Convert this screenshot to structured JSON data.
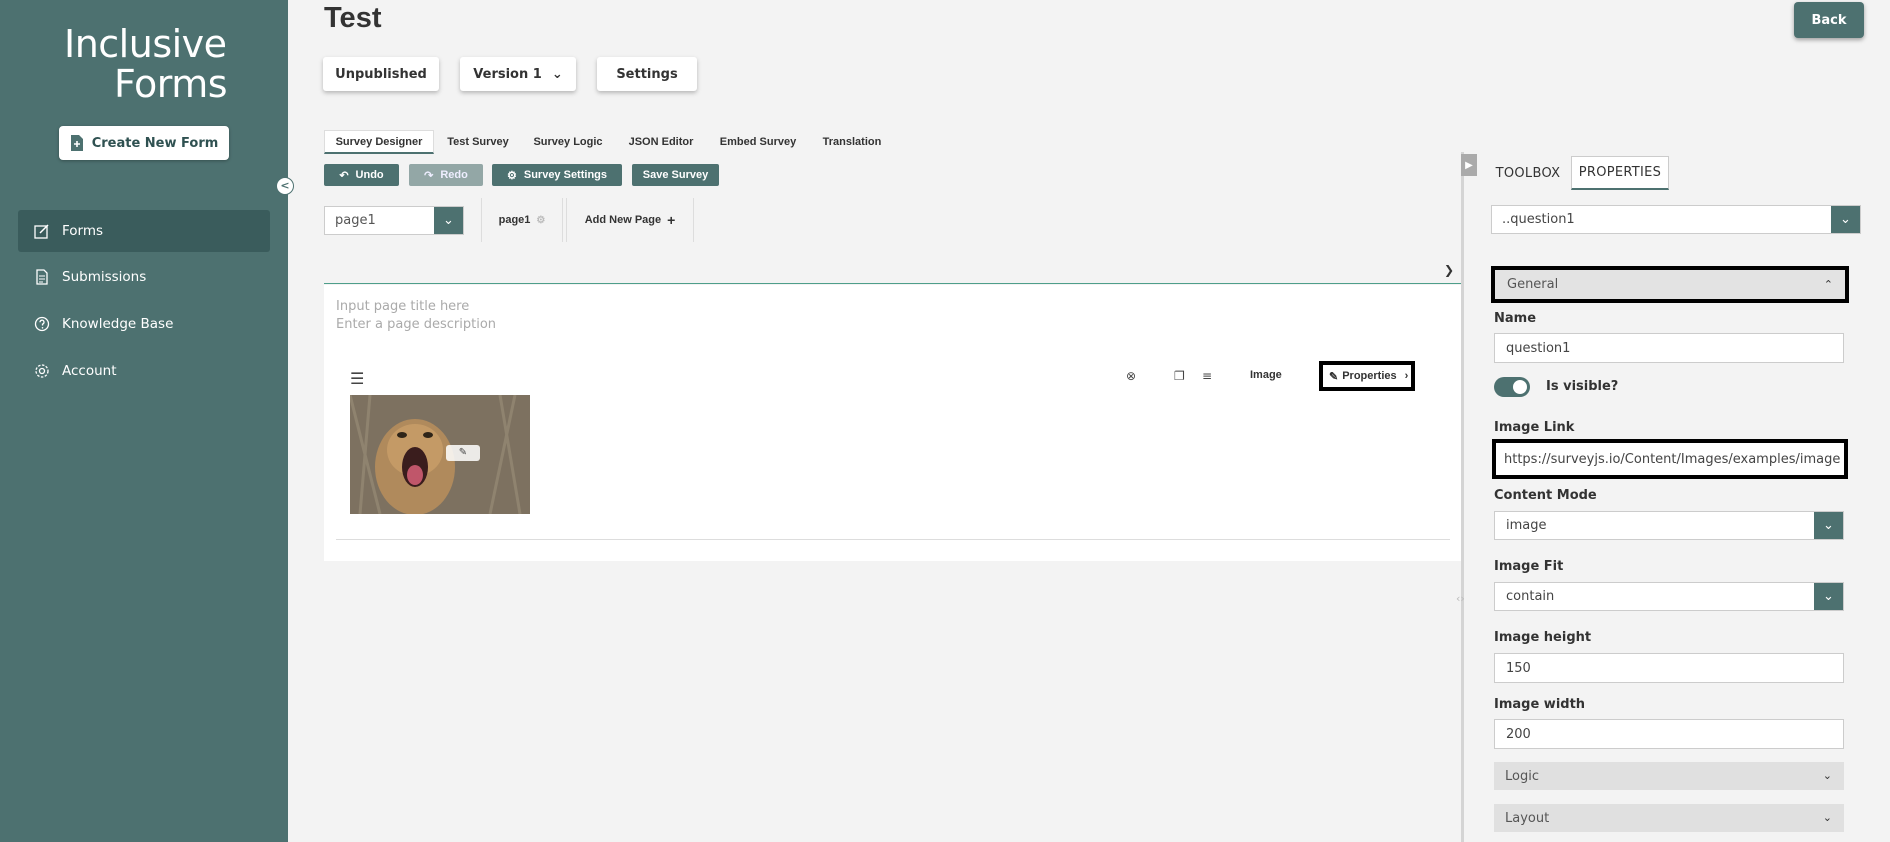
{
  "sidebar": {
    "logo_line1": "Inclusive",
    "logo_line2": "Forms",
    "create_label": "Create New Form",
    "collapse_glyph": "<",
    "items": [
      {
        "label": "Forms",
        "icon": "edit-icon"
      },
      {
        "label": "Submissions",
        "icon": "document-icon"
      },
      {
        "label": "Knowledge Base",
        "icon": "help-icon"
      },
      {
        "label": "Account",
        "icon": "gear-icon"
      }
    ]
  },
  "header": {
    "title": "Test",
    "back_label": "Back",
    "buttons": {
      "publish": "Unpublished",
      "version": "Version 1",
      "settings": "Settings"
    }
  },
  "designer": {
    "tabs": [
      "Survey Designer",
      "Test Survey",
      "Survey Logic",
      "JSON Editor",
      "Embed Survey",
      "Translation"
    ],
    "toolbar": {
      "undo": "Undo",
      "redo": "Redo",
      "survey_settings": "Survey Settings",
      "save": "Save Survey"
    },
    "page_select": "page1",
    "page_tab": "page1",
    "add_page": "Add New Page"
  },
  "canvas": {
    "title_placeholder": "Input page title here",
    "desc_placeholder": "Enter a page description",
    "question_type": "Image",
    "properties_label": "Properties"
  },
  "panel": {
    "tabs": [
      "TOOLBOX",
      "PROPERTIES"
    ],
    "object_select": "..question1",
    "section": "General",
    "name_label": "Name",
    "name_value": "question1",
    "visible_label": "Is visible?",
    "image_link_label": "Image Link",
    "image_link_value": "https://surveyjs.io/Content/Images/examples/image",
    "content_mode_label": "Content Mode",
    "content_mode_value": "image",
    "image_fit_label": "Image Fit",
    "image_fit_value": "contain",
    "image_height_label": "Image height",
    "image_height_value": "150",
    "image_width_label": "Image width",
    "image_width_value": "200",
    "logic": "Logic",
    "layout": "Layout"
  },
  "colors": {
    "accent": "#4d7170",
    "sidebar": "#4d7170",
    "active_nav": "#3a5c5c"
  }
}
